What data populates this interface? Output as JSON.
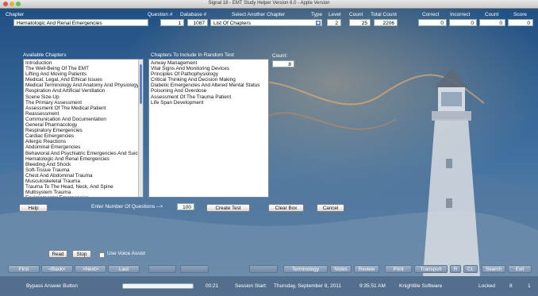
{
  "window": {
    "title": "Signal 18 - EMT Study Helper Version 6.0 - Apple Version"
  },
  "header": {
    "chapter_label": "Chapter",
    "chapter_value": "Hematologic And Renal Emergencies",
    "question_label": "Question #",
    "question_value": "1",
    "database_label": "Database #",
    "database_value": "1087",
    "select_chapter_label": "Select Another Chapter",
    "select_chapter_value": "List Of Chapters",
    "type_label": "Type",
    "level_label": "Level",
    "level_value": "2",
    "count_label": "Count",
    "count_value": "25",
    "total_count_label": "Total Count",
    "total_count_value": "2206",
    "correct_label": "Correct",
    "correct_value": "0",
    "incorrect_label": "Incorrect",
    "incorrect_value": "0",
    "count2_label": "Count",
    "count2_value": "0",
    "score_label": "Score",
    "score_value": "0"
  },
  "available": {
    "label": "Available Chapters",
    "items": [
      "Introduction",
      "The Well-Being Of The EMT",
      "Lifting And Moving Patients",
      "Medical, Legal, And Ethical Issues",
      "Medical Terminology And Anatomy And Physiology",
      "Respiration And Artificial Ventilation",
      "Scene Size-Up",
      "The Primary Assessment",
      "Assessment Of The Medical Patient",
      "Reassessment",
      "Communication And Documentation",
      "General Pharmacology",
      "Respiratory Emergencies",
      "Cardiac Emergencies",
      "Allergic Reactions",
      "Abdominal Emergencies",
      "Behavioral And Psychiatric Emergencies And Suicide",
      "Hematologic And Renal Emergencies",
      "Bleeding And Shock",
      "Soft-Tissue Trauma",
      "Chest And Abdominal Trauma",
      "Musculoskeletal Trauma",
      "Trauma To The Head, Neck, And Spine",
      "Multisystem Trauma",
      "Environmental Emergencies"
    ]
  },
  "random": {
    "label": "Chapters To Include In Random Test",
    "count_label": "Count:",
    "count_value": "8",
    "items": [
      "Airway Management",
      "Vital Signs And Monitoring Devices",
      "Principles Of Pathophysiology",
      "Critical Thinking And Decision Making",
      "Diabetic Emergencies And Altered Mental Status",
      "Poisoning And Overdose",
      "Assessment Of The Trauma Patient",
      "Life Span Development"
    ]
  },
  "controls": {
    "help": "Help",
    "enter_prompt": "Enter Number Of Questions -->",
    "num_questions": "100",
    "create_test": "Create Test",
    "clear_box": "Clear Box",
    "cancel": "Cancel",
    "read": "Read",
    "stop": "Stop",
    "voice_assist": "Use Voice Assist"
  },
  "toolbar": {
    "first": "First",
    "back": "<Back<",
    "next": ">Next>",
    "last": "Last",
    "terminology": "Terminology",
    "notes": "Notes",
    "review": "Review",
    "print": "Print",
    "transport": "Transport",
    "r": "R",
    "cl": "CL",
    "search": "Search",
    "exit": "Exit"
  },
  "status": {
    "bypass": "Bypass Answer Button",
    "timer": "00:21",
    "session_label": "Session Start:",
    "session_date": "Thursday, September 8, 2011",
    "time": "9:35:51 AM",
    "company": "Knightlite Software",
    "locked": "Locked",
    "locked_count": "8",
    "page": "1",
    "progress_fraction": 0.0
  },
  "colors": {
    "accent": "#5c82c5",
    "background": "#2c5a86"
  }
}
